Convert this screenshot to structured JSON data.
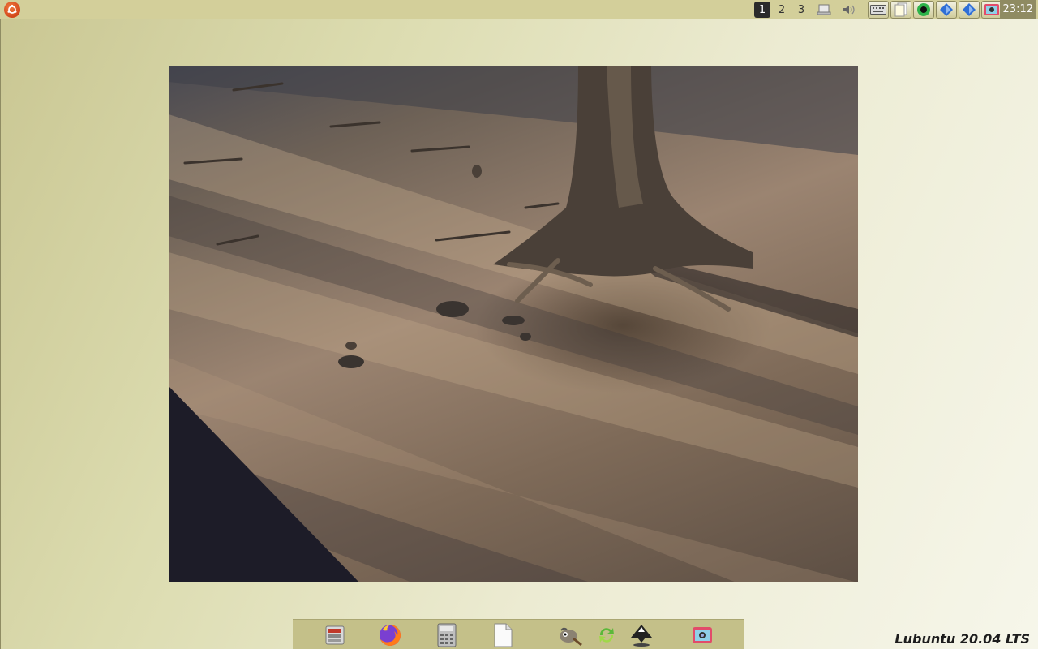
{
  "top_panel": {
    "menu_icon": "lubuntu-menu-icon",
    "desktops": [
      "1",
      "2",
      "3"
    ],
    "active_desktop": "1",
    "tray": [
      "removable-drive-icon",
      "volume-icon"
    ],
    "tasks": [
      "keyboard-icon",
      "notes-icon",
      "green-circle-app-icon",
      "blue-diamond-app-icon",
      "blue-diamond-app-icon",
      "screenshot-app-icon"
    ],
    "clock": "23:12"
  },
  "dock": {
    "items": [
      "file-manager-icon",
      "firefox-icon",
      "calculator-icon",
      "text-document-icon",
      "gimp-icon",
      "update-icon",
      "inkscape-icon",
      "screenshot-tool-icon"
    ]
  },
  "brand": "Lubuntu 20.04 LTS",
  "colors": {
    "panel": "#d3cf9a",
    "dock": "#c4c089",
    "active_desktop": "#2b2b2b"
  }
}
